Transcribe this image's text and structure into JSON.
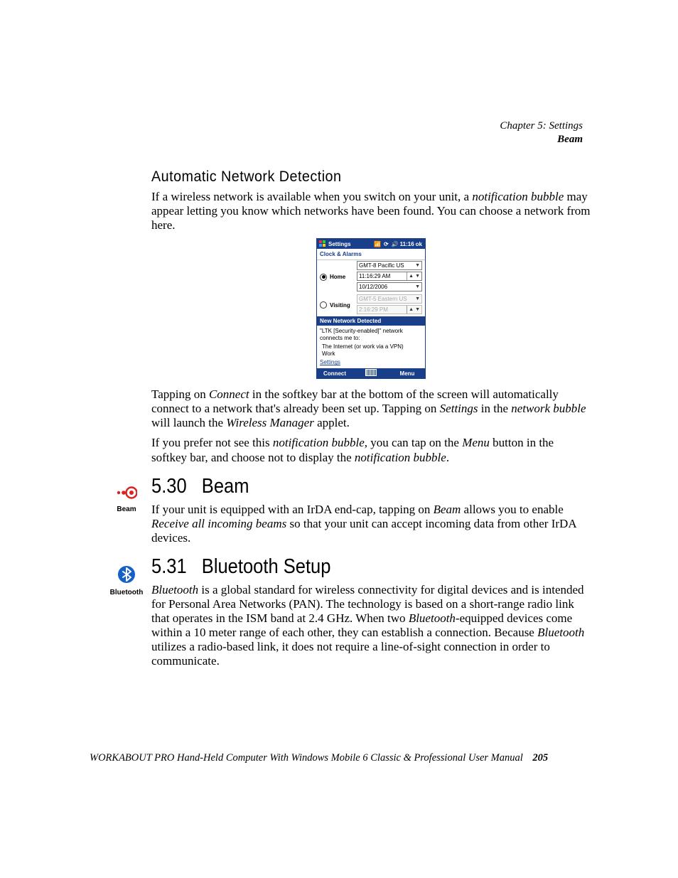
{
  "header": {
    "chapter": "Chapter  5:  Settings",
    "section": "Beam"
  },
  "auto_net": {
    "heading": "Automatic Network Detection",
    "p1_a": "If a wireless network is available when you switch on your unit, a ",
    "p1_i1": "notification bubble",
    "p1_b": " may appear letting you know which networks have been found. You can choose a network from here.",
    "p2_a": "Tapping on ",
    "p2_i1": "Connect",
    "p2_b": " in the softkey bar at the bottom of the screen will automatically connect to a network that's already been set up. Tapping on ",
    "p2_i2": "Settings",
    "p2_c": " in the ",
    "p2_i3": "network bubble",
    "p2_d": " will launch the ",
    "p2_i4": "Wireless Manager",
    "p2_e": " applet.",
    "p3_a": "If you prefer not see this ",
    "p3_i1": "notification bubble",
    "p3_b": ", you can tap on the ",
    "p3_i2": "Menu",
    "p3_c": " button in the softkey bar, and choose not to display the ",
    "p3_i3": "notification bubble",
    "p3_d": "."
  },
  "device": {
    "title": "Settings",
    "time": "11:16",
    "ok": "ok",
    "clock_alarms": "Clock & Alarms",
    "home": "Home",
    "visiting": "Visiting",
    "home_tz": "GMT-8 Pacific US",
    "home_time": "11:16:29 AM",
    "home_date": "10/12/2006",
    "visit_tz": "GMT-5 Eastern US",
    "visit_time": "2:16:29 PM",
    "notif_title": "New Network Detected",
    "notif_msg": "\"LTK [Security-enabled]\" network connects me to:",
    "opt1": "The Internet (or work via a VPN)",
    "opt2": "Work",
    "settings_link": "Settings",
    "sk_connect": "Connect",
    "sk_menu": "Menu"
  },
  "beam": {
    "num": "5.30",
    "title": "Beam",
    "icon_label": "Beam",
    "p_a": "If your unit is equipped with an IrDA end-cap, tapping on ",
    "p_i1": "Beam",
    "p_b": " allows you to enable ",
    "p_i2": "Receive all incoming beams",
    "p_c": " so that your unit can accept incoming data from other IrDA devices."
  },
  "bluetooth": {
    "num": "5.31",
    "title": "Bluetooth Setup",
    "icon_label": "Bluetooth",
    "p_i1": "Bluetooth",
    "p_a": " is a global standard for wireless connectivity for digital devices and is intended for Personal Area Networks (PAN). The technology is based on a short-range radio link that operates in the ISM band at 2.4 GHz. When two ",
    "p_i2": "Bluetooth",
    "p_b": "-equipped devices come within a 10 meter range of each other, they can establish a connection. Because ",
    "p_i3": "Bluetooth",
    "p_c": " utilizes a radio-based link, it does not require a line-of-sight connection in order to communicate."
  },
  "footer": {
    "text": "WORKABOUT PRO Hand-Held Computer With Windows Mobile 6 Classic & Professional User Manual",
    "page": "205"
  }
}
